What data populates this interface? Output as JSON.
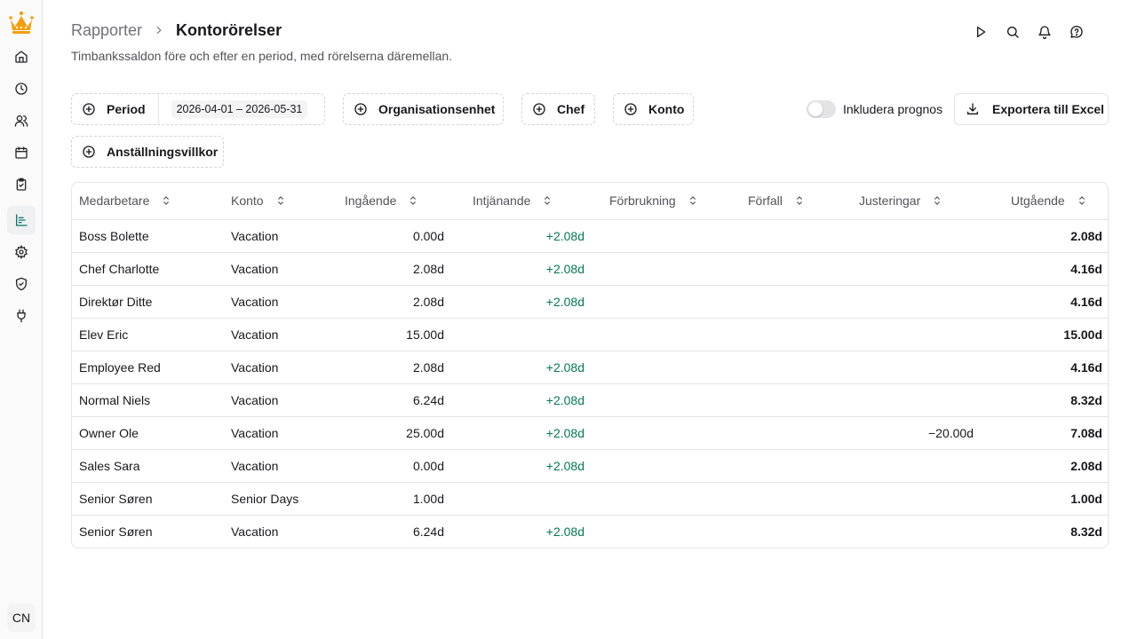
{
  "sidebar": {
    "logo": "crown-logo",
    "items": [
      {
        "name": "home",
        "icon": "home-icon"
      },
      {
        "name": "time",
        "icon": "clock-icon"
      },
      {
        "name": "users",
        "icon": "users-icon"
      },
      {
        "name": "calendar",
        "icon": "calendar-icon"
      },
      {
        "name": "tasks",
        "icon": "clipboard-check-icon"
      },
      {
        "name": "reports",
        "icon": "chart-icon",
        "active": true
      },
      {
        "name": "settings",
        "icon": "gear-icon"
      },
      {
        "name": "security",
        "icon": "shield-check-icon"
      },
      {
        "name": "integrations",
        "icon": "plug-icon"
      }
    ],
    "avatar": "CN"
  },
  "header": {
    "parent": "Rapporter",
    "current": "Kontorörelser",
    "subtitle": "Timbankssaldon före och efter en period, med rörelserna däremellan."
  },
  "filters": {
    "period_label": "Period",
    "period_value": "2026-04-01 – 2026-05-31",
    "org_label": "Organisationsenhet",
    "chef_label": "Chef",
    "konto_label": "Konto",
    "terms_label": "Anställningsvillkor",
    "forecast_label": "Inkludera prognos",
    "forecast_on": false,
    "export_label": "Exportera till Excel"
  },
  "colors": {
    "accent": "#0f766e",
    "positive": "#047857",
    "logo": "#f59e0b"
  },
  "table": {
    "columns": [
      "Medarbetare",
      "Konto",
      "Ingående",
      "Intjänande",
      "Förbrukning",
      "Förfall",
      "Justeringar",
      "Utgående"
    ],
    "rows": [
      [
        "Boss Bolette",
        "Vacation",
        "0.00d",
        "+2.08d",
        "",
        "",
        "",
        "2.08d"
      ],
      [
        "Chef Charlotte",
        "Vacation",
        "2.08d",
        "+2.08d",
        "",
        "",
        "",
        "4.16d"
      ],
      [
        "Direktør Ditte",
        "Vacation",
        "2.08d",
        "+2.08d",
        "",
        "",
        "",
        "4.16d"
      ],
      [
        "Elev Eric",
        "Vacation",
        "15.00d",
        "",
        "",
        "",
        "",
        "15.00d"
      ],
      [
        "Employee Red",
        "Vacation",
        "2.08d",
        "+2.08d",
        "",
        "",
        "",
        "4.16d"
      ],
      [
        "Normal Niels",
        "Vacation",
        "6.24d",
        "+2.08d",
        "",
        "",
        "",
        "8.32d"
      ],
      [
        "Owner Ole",
        "Vacation",
        "25.00d",
        "+2.08d",
        "",
        "",
        "−20.00d",
        "7.08d"
      ],
      [
        "Sales Sara",
        "Vacation",
        "0.00d",
        "+2.08d",
        "",
        "",
        "",
        "2.08d"
      ],
      [
        "Senior Søren",
        "Senior Days",
        "1.00d",
        "",
        "",
        "",
        "",
        "1.00d"
      ],
      [
        "Senior Søren",
        "Vacation",
        "6.24d",
        "+2.08d",
        "",
        "",
        "",
        "8.32d"
      ]
    ]
  }
}
